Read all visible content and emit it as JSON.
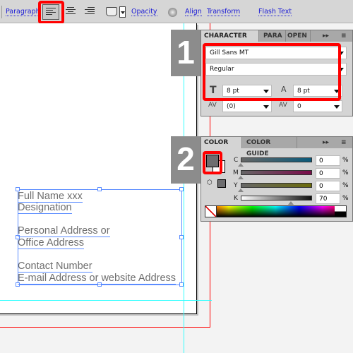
{
  "toolbar": {
    "paragraph": "Paragraph",
    "opacity": "Opacity",
    "align": "Align",
    "transform": "Transform",
    "flash_text": "Flash Text",
    "icons": [
      "align-left-icon",
      "align-center-icon",
      "align-right-icon",
      "envelope-shape-icon",
      "gear-icon"
    ]
  },
  "steps": [
    "1",
    "2"
  ],
  "character_panel": {
    "tabs": [
      "CHARACTER",
      "PARA",
      "OPEN"
    ],
    "font_family": "Gill Sans MT",
    "font_style": "Regular",
    "font_size": "8 pt",
    "leading": "8 pt",
    "kerning": "(0)",
    "tracking": "0"
  },
  "color_panel": {
    "tabs": [
      "COLOR",
      "COLOR GUIDE"
    ],
    "channels": [
      {
        "label": "C",
        "value": "0",
        "unit": "%"
      },
      {
        "label": "M",
        "value": "0",
        "unit": "%"
      },
      {
        "label": "Y",
        "value": "0",
        "unit": "%"
      },
      {
        "label": "K",
        "value": "70",
        "unit": "%"
      }
    ],
    "fill_color": "#6d6d6f",
    "accent": "#ff0000"
  },
  "text_frame": {
    "lines": [
      "Full Name xxx",
      "Designation",
      "Personal Address or",
      "Office Address",
      "Contact Number",
      "E-mail Address or website Address"
    ]
  }
}
